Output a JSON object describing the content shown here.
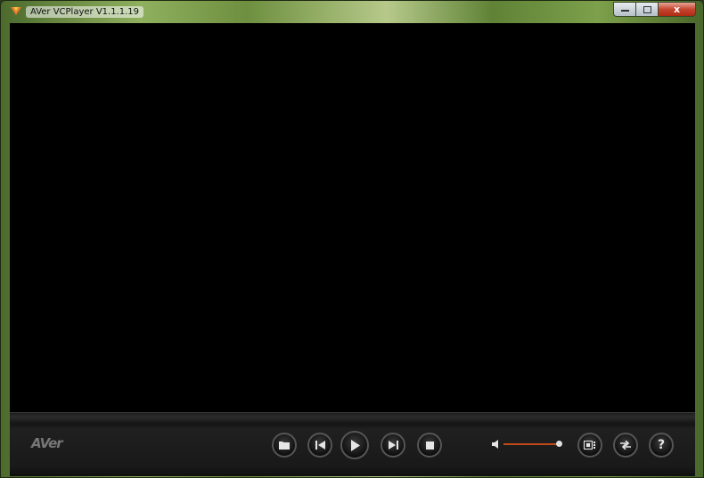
{
  "window": {
    "title": "AVer VCPlayer V1.1.1.19"
  },
  "title_controls": {
    "close_label": "x"
  },
  "brand": {
    "logo_text": "AVer"
  },
  "controls": {
    "open": {
      "icon": "folder-icon"
    },
    "previous": {
      "icon": "skip-previous-icon"
    },
    "play": {
      "icon": "play-icon"
    },
    "next": {
      "icon": "skip-next-icon"
    },
    "stop": {
      "icon": "stop-icon"
    },
    "volume": {
      "icon": "speaker-icon",
      "level": 1.0
    },
    "layout": {
      "icon": "layout-icon"
    },
    "swap": {
      "icon": "swap-icon"
    },
    "help": {
      "icon": "help-icon",
      "label": "?"
    }
  },
  "colors": {
    "volume_accent": "#c04a18",
    "video_background": "#000000"
  }
}
